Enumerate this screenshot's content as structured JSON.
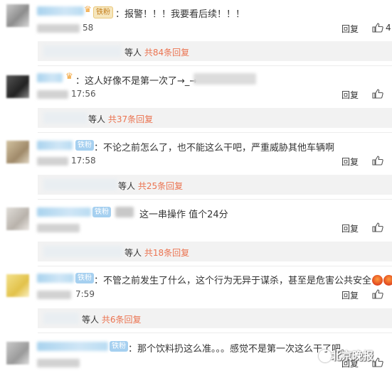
{
  "badges": {
    "iron": "铁粉",
    "gold": "铁粉"
  },
  "reply_label": "回复",
  "comments": [
    {
      "text": "：报警！！！我要看后续！！！",
      "time": "58",
      "likes": "4",
      "replies_who": "等人",
      "replies_count": "共84条回复"
    },
    {
      "text": "：这人好像不是第一次了→_→",
      "time": "17:56",
      "likes": "",
      "replies_who": "等人",
      "replies_count": "共37条回复"
    },
    {
      "text": "：不论之前怎么了，也不能这么干吧，严重威胁其他车辆啊",
      "time": "17:58",
      "likes": "",
      "replies_who": "等人",
      "replies_count": "共25条回复"
    },
    {
      "text": "这一串操作  值个24分",
      "time": "",
      "likes": "",
      "replies_who": "等人",
      "replies_count": "共18条回复"
    },
    {
      "text": "：不管之前发生了什么，这个行为无异于谋杀，甚至是危害公共安全",
      "time": "7:59",
      "likes": "",
      "replies_who": "等人",
      "replies_count": "共6条回复"
    },
    {
      "text": "：那个饮料扔这么准。。。感觉不是第一次这么干了吧。",
      "time": "",
      "likes": ""
    }
  ],
  "watermark": "北京晚报",
  "colors": {
    "accent": "#eb7350",
    "badge": "#a6d0f0",
    "reply_bg": "#f2f2f2"
  }
}
